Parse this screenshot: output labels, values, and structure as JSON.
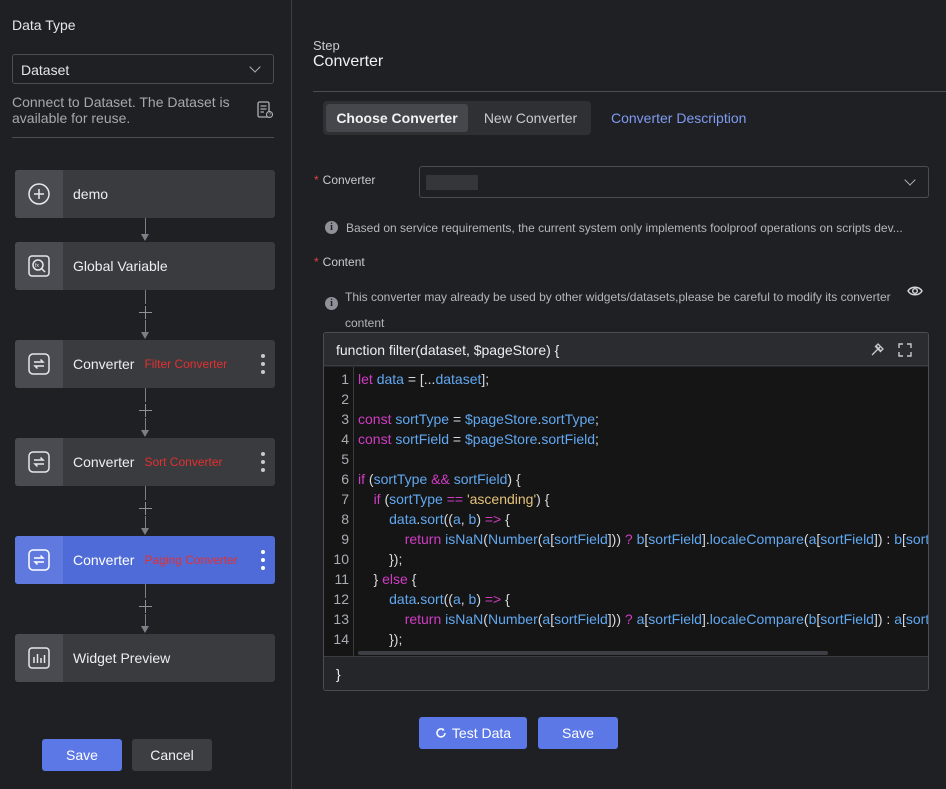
{
  "sidebar": {
    "data_type_label": "Data Type",
    "data_type_value": "Dataset",
    "hint": "Connect to Dataset. The Dataset is available for reuse.",
    "nodes": [
      {
        "name": "demo",
        "tag": "",
        "icon": "plus-circle-icon"
      },
      {
        "name": "Global Variable",
        "tag": "",
        "icon": "global-variable-icon"
      },
      {
        "name": "Converter",
        "tag": "Filter Converter",
        "icon": "converter-icon"
      },
      {
        "name": "Converter",
        "tag": "Sort Converter",
        "icon": "converter-icon"
      },
      {
        "name": "Converter",
        "tag": "Paging Converter",
        "icon": "converter-icon",
        "active": true
      },
      {
        "name": "Widget Preview",
        "tag": "",
        "icon": "chart-icon"
      }
    ],
    "save_label": "Save",
    "cancel_label": "Cancel"
  },
  "main": {
    "step_label": "Step",
    "step_title": "Converter",
    "tabs": [
      {
        "label": "Choose Converter",
        "selected": true
      },
      {
        "label": "New Converter",
        "selected": false
      }
    ],
    "description_link": "Converter Description",
    "converter_field": {
      "label": "Converter",
      "value": ""
    },
    "notice": "Based on service requirements, the current system only implements foolproof operations on scripts dev...",
    "content_label": "Content",
    "warning": "This converter may already be used by other widgets/datasets,please be careful to modify its converter content",
    "warning_line1": "This converter may already be used by other widgets/datasets,please be careful to modify its converter",
    "warning_line2": "content",
    "editor": {
      "header": "function filter(dataset, $pageStore) {",
      "footer": "}",
      "lines": [
        "1",
        "2",
        "3",
        "4",
        "5",
        "6",
        "7",
        "8",
        "9",
        "10",
        "11",
        "12",
        "13",
        "14"
      ]
    },
    "test_data_label": "Test Data",
    "save_label": "Save"
  },
  "colors": {
    "accent": "#5b78e6",
    "active_node": "#4f6bd8",
    "tag_red": "#e3302f",
    "keyword": "#d13cc4",
    "identifier": "#61a8f0"
  }
}
